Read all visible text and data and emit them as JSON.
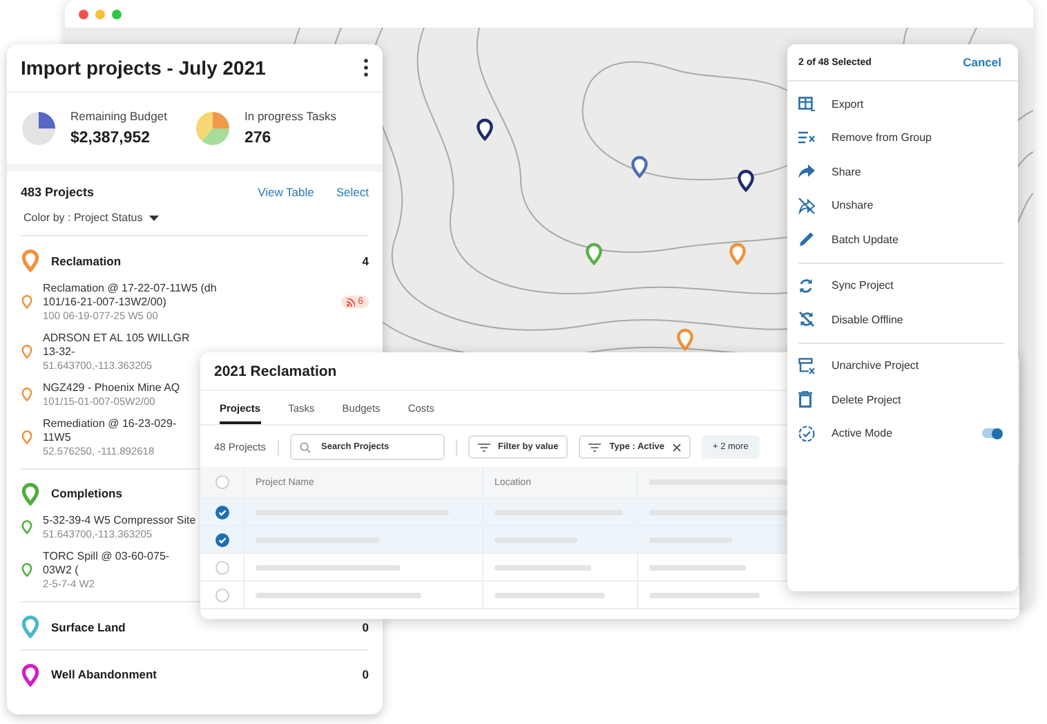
{
  "browser_window": {
    "controls": [
      {
        "color": "#f0524f"
      },
      {
        "color": "#f7be3b"
      },
      {
        "color": "#33c748"
      }
    ]
  },
  "project_panel": {
    "title": "Import projects - July 2021",
    "stats": [
      {
        "kind": "budget",
        "label": "Remaining Budget",
        "value": "$2,387,952"
      },
      {
        "kind": "tasks",
        "label": "In progress Tasks",
        "value": "276"
      }
    ],
    "project_count": "483 Projects",
    "links": [
      "View Table",
      "Select"
    ],
    "color_by": "Color by : Project Status",
    "groups": [
      {
        "name": "Reclamation",
        "color": "#f0923a",
        "count": "4",
        "items": [
          {
            "title": "Reclamation @ 17-22-07-11W5 (dh 101/16-21-007-13W2/00)",
            "subtitle": "100 06-19-077-25 W5 00",
            "badge": "6"
          },
          {
            "title": "ADRSON ET AL 105 WILLGR 13-32-",
            "subtitle": "51.643700,-113.363205"
          },
          {
            "title": "NGZ429 - Phoenix Mine AQ",
            "subtitle": "101/15-01-007-05W2/00"
          },
          {
            "title": "Remediation @ 16-23-029-11W5",
            "subtitle": "52.576250, -111.892618"
          }
        ]
      },
      {
        "name": "Completions",
        "color": "#4caf3a",
        "items": [
          {
            "title": "5-32-39-4 W5 Compressor Site",
            "subtitle": "51.643700,-113.363205"
          },
          {
            "title": "TORC Spill @ 03-60-075-03W2 (",
            "subtitle": "2-5-7-4 W2"
          }
        ]
      },
      {
        "name": "Surface Land",
        "color": "#4bb8c8",
        "count": "0"
      },
      {
        "name": "Well Abandonment",
        "color": "#d21fc4",
        "count": "0"
      }
    ]
  },
  "table_window": {
    "title": "2021 Reclamation",
    "tabs": [
      {
        "label": "Projects",
        "selected": true
      },
      {
        "label": "Tasks",
        "selected": false
      },
      {
        "label": "Budgets",
        "selected": false
      },
      {
        "label": "Costs",
        "selected": false
      }
    ],
    "count": "48 Projects",
    "search": {
      "placeholder": "Search Projects"
    },
    "filters": [
      {
        "kind": "filter",
        "label": "Filter by value"
      },
      {
        "kind": "chip",
        "label": "Type : Active"
      },
      {
        "kind": "more",
        "label": "+ 2 more"
      }
    ],
    "select_all_checked": false,
    "columns": [
      "Project Name",
      "Location"
    ],
    "rows": [
      {
        "checked": true
      },
      {
        "checked": true
      },
      {
        "checked": false
      },
      {
        "checked": false
      }
    ]
  },
  "action_menu": {
    "selection": "2 of 48 Selected",
    "cancel": "Cancel",
    "groups": [
      [
        {
          "kind": "action",
          "label": "Export"
        },
        {
          "kind": "action",
          "label": "Remove from Group"
        },
        {
          "kind": "action",
          "label": "Share"
        },
        {
          "kind": "action",
          "label": "Unshare"
        },
        {
          "kind": "action",
          "label": "Batch Update"
        }
      ],
      [
        {
          "kind": "action",
          "label": "Sync Project"
        },
        {
          "kind": "action",
          "label": "Disable Offline"
        }
      ],
      [
        {
          "kind": "action",
          "label": "Unarchive Project"
        },
        {
          "kind": "action",
          "label": "Delete Project"
        },
        {
          "kind": "toggle",
          "label": "Active Mode",
          "on": true
        }
      ]
    ]
  }
}
